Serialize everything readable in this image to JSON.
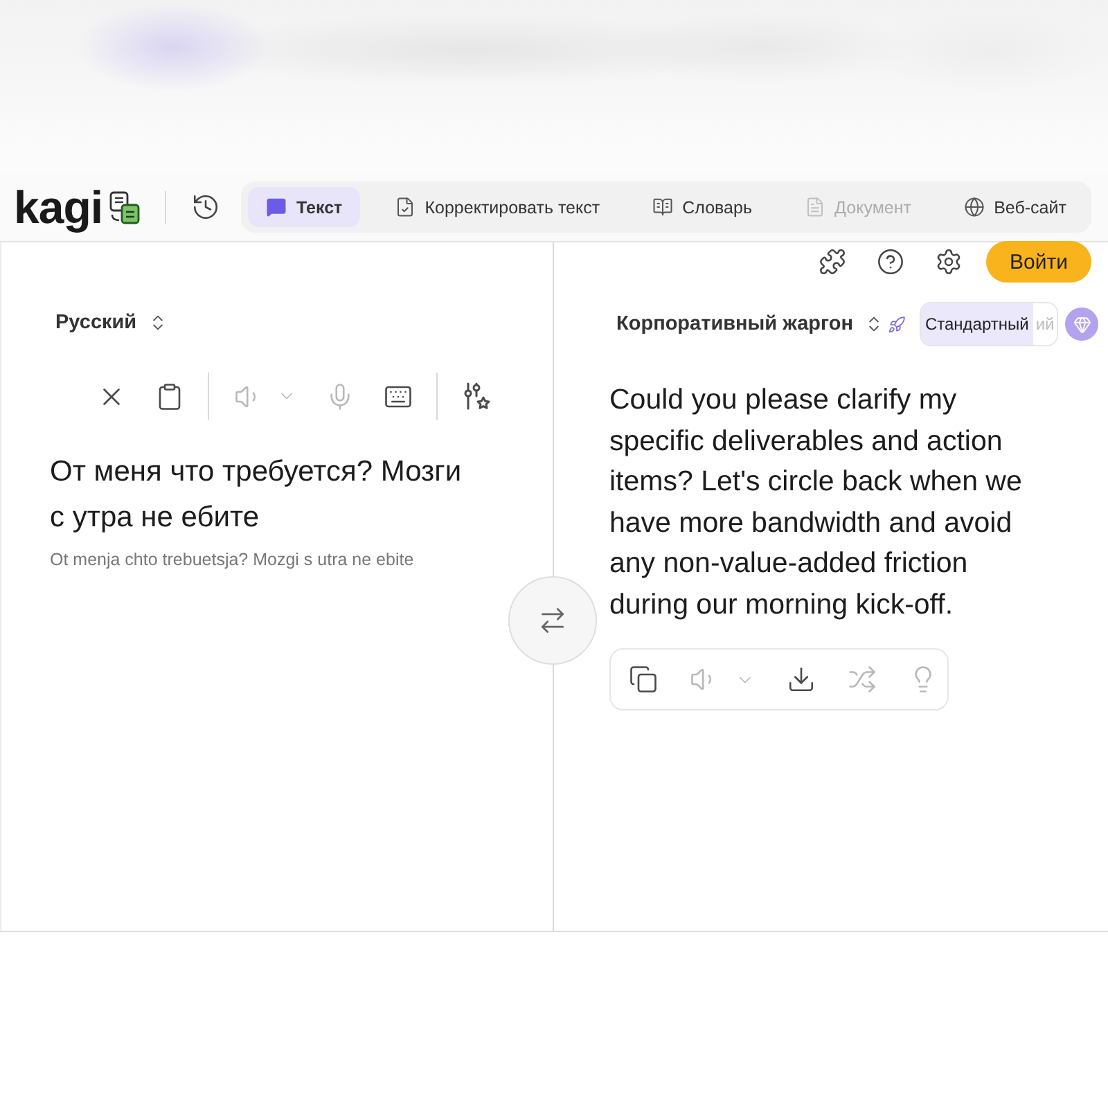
{
  "header": {
    "logo": "kagi",
    "tabs": [
      {
        "kind": "text",
        "label": "Текст",
        "selected": true,
        "disabled": false
      },
      {
        "kind": "proofread",
        "label": "Корректировать текст",
        "selected": false,
        "disabled": false
      },
      {
        "kind": "dictionary",
        "label": "Словарь",
        "selected": false,
        "disabled": false
      },
      {
        "kind": "document",
        "label": "Документ",
        "selected": false,
        "disabled": true
      },
      {
        "kind": "website",
        "label": "Веб-сайт",
        "selected": false,
        "disabled": false
      }
    ]
  },
  "account": {
    "login_button": "Войти"
  },
  "source": {
    "language": "Русский",
    "tool_groups": [
      [
        {
          "kind": "clear",
          "disabled": false
        },
        {
          "kind": "paste",
          "disabled": false
        }
      ],
      [
        {
          "kind": "speak",
          "disabled": true
        },
        {
          "kind": "voice_menu",
          "disabled": true
        },
        {
          "kind": "microphone",
          "disabled": true
        },
        {
          "kind": "keyboard",
          "disabled": false
        }
      ],
      [
        {
          "kind": "preferences",
          "disabled": false
        }
      ]
    ],
    "text": "От меня что требуется? Мозги с утра не ебите",
    "transliteration": "Ot menja chto trebuetsja? Mozgi s utra ne ebite"
  },
  "target": {
    "language": "Корпоративный жаргон",
    "style_options": [
      {
        "label": "Стандартный",
        "selected": true
      },
      {
        "label": "ий",
        "selected": false
      }
    ],
    "text": "Could you please clarify my specific deliverables and action items? Let's circle back when we have more bandwidth and avoid any non-value-added friction during our morning kick-off.",
    "tools": [
      {
        "kind": "copy",
        "disabled": false
      },
      {
        "kind": "speak",
        "disabled": true
      },
      {
        "kind": "voice_menu",
        "disabled": true
      },
      {
        "kind": "download",
        "disabled": false
      },
      {
        "kind": "shuffle",
        "disabled": true
      },
      {
        "kind": "explain",
        "disabled": true
      }
    ]
  }
}
